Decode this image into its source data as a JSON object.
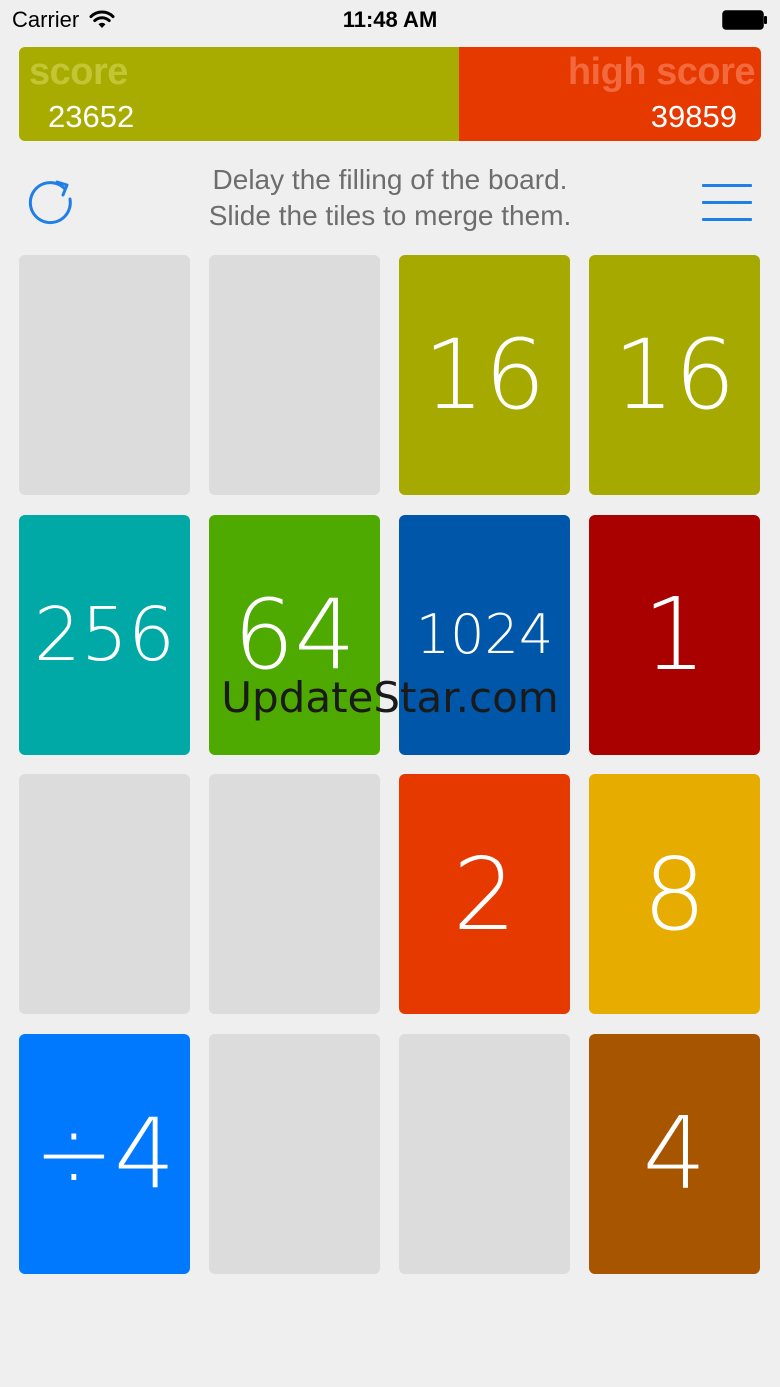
{
  "status_bar": {
    "carrier": "Carrier",
    "time": "11:48 AM"
  },
  "scores": {
    "score_label": "score",
    "score_value": "23652",
    "high_label": "high score",
    "high_value": "39859",
    "score_color": "#a8ab00",
    "high_color": "#e63900"
  },
  "info": {
    "line1": "Delay the filling of the board.",
    "line2": "Slide the tiles to merge them.",
    "refresh_icon": "refresh-icon",
    "menu_icon": "hamburger-menu-icon",
    "accent_color": "#1f7fe6"
  },
  "board": {
    "rows": [
      [
        {
          "value": "",
          "color": ""
        },
        {
          "value": "",
          "color": ""
        },
        {
          "value": "16",
          "color": "#a6a900"
        },
        {
          "value": "16",
          "color": "#a6a900"
        }
      ],
      [
        {
          "value": "256",
          "color": "#00a9a6"
        },
        {
          "value": "64",
          "color": "#4ea900"
        },
        {
          "value": "1024",
          "color": "#0057a9"
        },
        {
          "value": "1",
          "color": "#a90000"
        }
      ],
      [
        {
          "value": "",
          "color": ""
        },
        {
          "value": "",
          "color": ""
        },
        {
          "value": "2",
          "color": "#e63900"
        },
        {
          "value": "8",
          "color": "#e6ac00"
        }
      ],
      [
        {
          "value": "÷4",
          "color": "#0079ff"
        },
        {
          "value": "",
          "color": ""
        },
        {
          "value": "",
          "color": ""
        },
        {
          "value": "4",
          "color": "#a85500"
        }
      ]
    ]
  },
  "watermark": "UpdateStar.com"
}
